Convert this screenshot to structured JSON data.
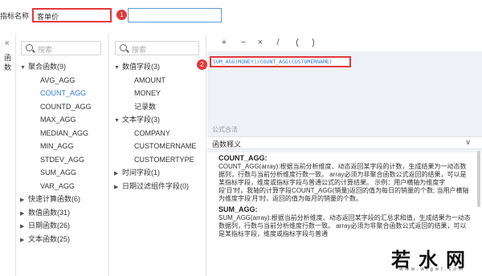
{
  "indicator": {
    "label": "指标名称",
    "value": "客单价"
  },
  "badges": [
    "1",
    "2"
  ],
  "side_tab": {
    "label": "函数"
  },
  "functions_panel": {
    "search_placeholder": "搜索",
    "items": [
      {
        "type": "group",
        "label": "聚合函数(9)",
        "expanded": true
      },
      {
        "type": "child",
        "label": "AVG_AGG"
      },
      {
        "type": "child",
        "label": "COUNT_AGG",
        "selected": true
      },
      {
        "type": "child",
        "label": "COUNTD_AGG"
      },
      {
        "type": "child",
        "label": "MAX_AGG"
      },
      {
        "type": "child",
        "label": "MEDIAN_AGG"
      },
      {
        "type": "child",
        "label": "MIN_AGG"
      },
      {
        "type": "child",
        "label": "STDEV_AGG"
      },
      {
        "type": "child",
        "label": "SUM_AGG"
      },
      {
        "type": "child",
        "label": "VAR_AGG"
      },
      {
        "type": "group",
        "label": "快速计算函数(6)",
        "expanded": false
      },
      {
        "type": "group",
        "label": "数值函数(31)",
        "expanded": false
      },
      {
        "type": "group",
        "label": "日期函数(26)",
        "expanded": false
      },
      {
        "type": "group",
        "label": "文本函数(25)",
        "expanded": false
      }
    ]
  },
  "fields_panel": {
    "search_placeholder": "搜索",
    "items": [
      {
        "type": "group",
        "label": "数值字段(3)",
        "expanded": true
      },
      {
        "type": "child",
        "label": "AMOUNT"
      },
      {
        "type": "child",
        "label": "MONEY"
      },
      {
        "type": "child",
        "label": "记录数"
      },
      {
        "type": "group",
        "label": "文本字段(3)",
        "expanded": true
      },
      {
        "type": "child",
        "label": "COMPANY"
      },
      {
        "type": "child",
        "label": "CUSTOMERNAME"
      },
      {
        "type": "child",
        "label": "CUSTOMERTYPE"
      },
      {
        "type": "group",
        "label": "时间字段(1)",
        "expanded": false
      },
      {
        "type": "group",
        "label": "日期过滤组件字段(0)",
        "expanded": false
      }
    ]
  },
  "toolbar": {
    "buttons": [
      "+",
      "−",
      "×",
      "/",
      "(",
      ")"
    ]
  },
  "formula": {
    "text": "SUM_AGG(MONEY)/COUNT_AGG(CUSTOMERNAME)"
  },
  "legal_label": "公式合法",
  "explanation": {
    "title": "函数释义",
    "entries": [
      {
        "name": "COUNT_AGG:",
        "text": "COUNT_AGG(array):根据当前分析维度、动态返回某字段的计数，生成结果为一动态数据列，行数与当前分析维度行数一致。 array必须为非聚合函数公式返回的结果，可以是某指标字段，维度或指标字段与普通公式的计算结果。 示例：用户横轴为维度字段'日'时，我轴的计算字段COUNT_AGG(销量)返回的值为每日的销量的个数; 当用户横轴为维度字段'月'时，返回的值为每月的销量的个数。"
      },
      {
        "name": "SUM_AGG:",
        "text": "SUM_AGG(array):根据当前分析维度、动态返回某字段的汇总求和值，生成结果为一动态数据列，行数与当前分析维度行数一致。 array必须为非聚合函数公式返回的结果，可以是某指标字段，维度或指标字段与普通"
      }
    ]
  },
  "watermark": {
    "big": "若水网",
    "small": "www.wtgwt.com"
  }
}
